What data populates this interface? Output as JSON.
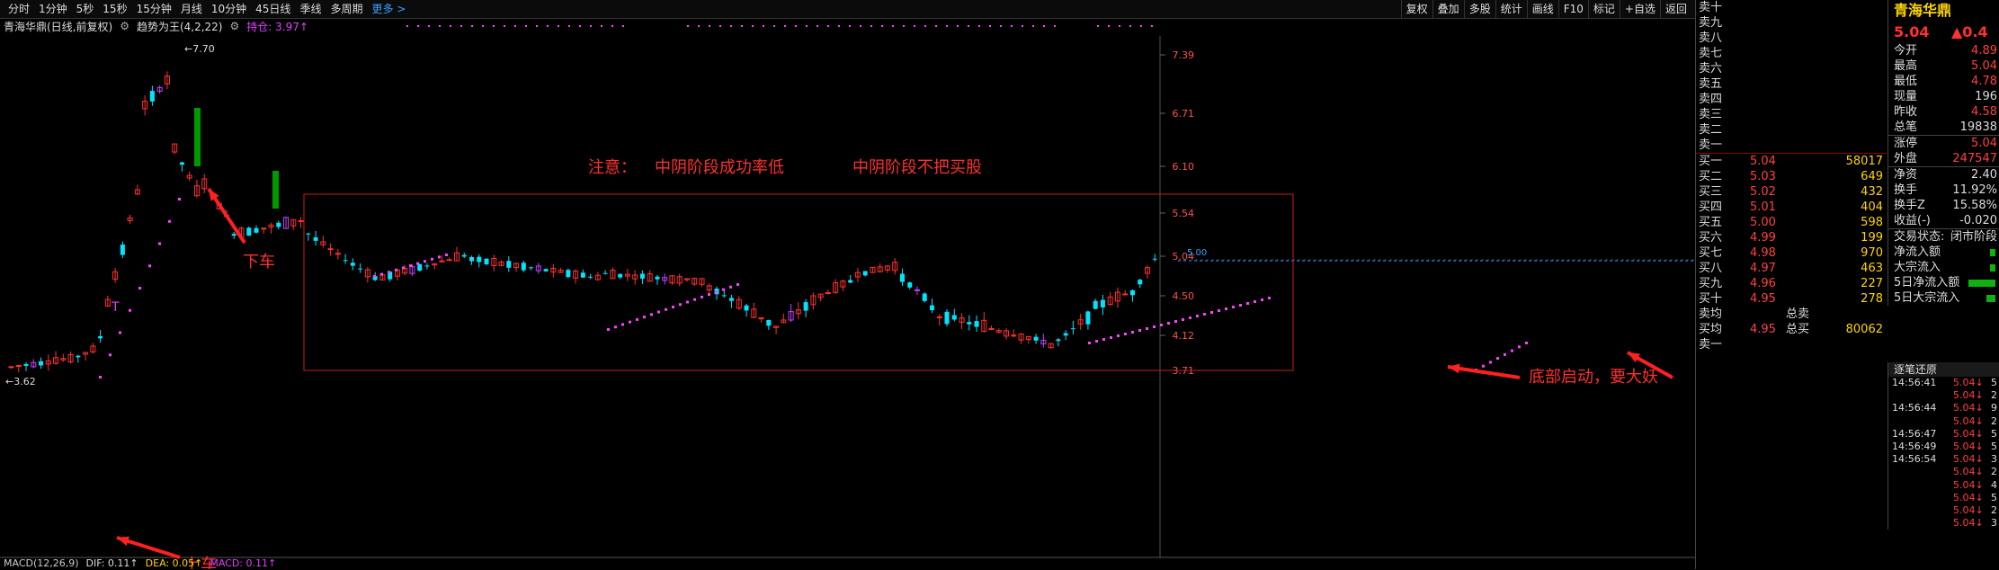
{
  "toolbar": {
    "tabs": [
      "分时",
      "1分钟",
      "5秒",
      "15秒",
      "15分钟",
      "月线",
      "10分钟",
      "45日线",
      "季线",
      "多周期",
      "更多 >"
    ],
    "tools": [
      "复权",
      "叠加",
      "多股",
      "统计",
      "画线",
      "F10",
      "标记",
      "+自选",
      "返回"
    ]
  },
  "info": {
    "stock": "青海华鼎(日线,前复权)",
    "indicator": "趋势为王(4,2,22)",
    "hold": "持仓: 3.97↑"
  },
  "macd": {
    "label": "MACD(12,26,9)",
    "dif": "DIF: 0.11↑",
    "dea": "DEA: 0.05↑",
    "macd": "MACD: 0.11↑"
  },
  "chart_data": {
    "type": "candlestick",
    "y_axis_ticks": [
      "7.39",
      "6.71",
      "6.10",
      "5.54",
      "5.04",
      "4.50",
      "4.12",
      "3.71"
    ],
    "high_label": "7.70",
    "low_label": "3.62",
    "line_label": "5.00",
    "annotations": {
      "warning": "注意：",
      "note1": "中阴阶段成功率低",
      "note2": "中阴阶段不把买股",
      "get_off": "下车",
      "get_on": "上车",
      "bottom": "底部启动，要大妖",
      "t_mark": "T"
    },
    "colors": {
      "up": "#ff3030",
      "down": "#00e5ff",
      "green": "#009900",
      "purple": "#c040ff",
      "dots": "#ff40ff"
    }
  },
  "panel": {
    "name": "青海华鼎",
    "price": "5.04",
    "change": "▲0.4",
    "sell": [
      {
        "label": "卖十",
        "price": "",
        "vol": ""
      },
      {
        "label": "卖九",
        "price": "",
        "vol": ""
      },
      {
        "label": "卖八",
        "price": "",
        "vol": ""
      },
      {
        "label": "卖七",
        "price": "",
        "vol": ""
      },
      {
        "label": "卖六",
        "price": "",
        "vol": ""
      },
      {
        "label": "卖五",
        "price": "",
        "vol": ""
      },
      {
        "label": "卖四",
        "price": "",
        "vol": ""
      },
      {
        "label": "卖三",
        "price": "",
        "vol": ""
      },
      {
        "label": "卖二",
        "price": "",
        "vol": ""
      },
      {
        "label": "卖一",
        "price": "",
        "vol": ""
      }
    ],
    "buy": [
      {
        "label": "买一",
        "price": "5.04",
        "vol": "58017"
      },
      {
        "label": "买二",
        "price": "5.03",
        "vol": "649"
      },
      {
        "label": "买三",
        "price": "5.02",
        "vol": "432"
      },
      {
        "label": "买四",
        "price": "5.01",
        "vol": "404"
      },
      {
        "label": "买五",
        "price": "5.00",
        "vol": "598"
      },
      {
        "label": "买六",
        "price": "4.99",
        "vol": "199"
      },
      {
        "label": "买七",
        "price": "4.98",
        "vol": "970"
      },
      {
        "label": "买八",
        "price": "4.97",
        "vol": "463"
      },
      {
        "label": "买九",
        "price": "4.96",
        "vol": "227"
      },
      {
        "label": "买十",
        "price": "4.95",
        "vol": "278"
      }
    ],
    "avg": [
      {
        "label": "卖均",
        "price": "",
        "k": "总卖",
        "vol": ""
      },
      {
        "label": "买均",
        "price": "4.95",
        "k": "总买",
        "vol": "80062"
      }
    ],
    "extra": "卖一",
    "stats": [
      {
        "k": "今开",
        "v": "4.89"
      },
      {
        "k": "最高",
        "v": "5.04"
      },
      {
        "k": "最低",
        "v": "4.78"
      },
      {
        "k": "现量",
        "v": "196"
      },
      {
        "k": "昨收",
        "v": "4.58"
      },
      {
        "k": "总笔",
        "v": "19838"
      },
      {
        "k": "涨停",
        "v": "5.04"
      },
      {
        "k": "外盘",
        "v": "247547"
      },
      {
        "k": "净资",
        "v": "2.40"
      },
      {
        "k": "换手",
        "v": "11.92%"
      },
      {
        "k": "换手Z",
        "v": "15.58%"
      },
      {
        "k": "收益(-)",
        "v": "-0.020"
      },
      {
        "k": "交易状态:",
        "v": "闭市阶段"
      },
      {
        "k": "净流入额",
        "v": ""
      },
      {
        "k": "大宗流入",
        "v": ""
      },
      {
        "k": "5日净流入额",
        "v": ""
      },
      {
        "k": "5日大宗流入",
        "v": ""
      }
    ],
    "ticks_header": "逐笔还原",
    "ticks": [
      {
        "t": "14:56:41",
        "p": "5.04",
        "v": "5"
      },
      {
        "t": "",
        "p": "5.04",
        "v": "2"
      },
      {
        "t": "14:56:44",
        "p": "5.04",
        "v": "9"
      },
      {
        "t": "",
        "p": "5.04",
        "v": "2"
      },
      {
        "t": "14:56:47",
        "p": "5.04",
        "v": "5"
      },
      {
        "t": "14:56:49",
        "p": "5.04",
        "v": "5"
      },
      {
        "t": "14:56:54",
        "p": "5.04",
        "v": "3"
      },
      {
        "t": "",
        "p": "5.04",
        "v": "2"
      },
      {
        "t": "",
        "p": "5.04",
        "v": "4"
      },
      {
        "t": "",
        "p": "5.04",
        "v": "5"
      },
      {
        "t": "",
        "p": "5.04",
        "v": "2"
      },
      {
        "t": "",
        "p": "5.04",
        "v": "3"
      }
    ]
  }
}
